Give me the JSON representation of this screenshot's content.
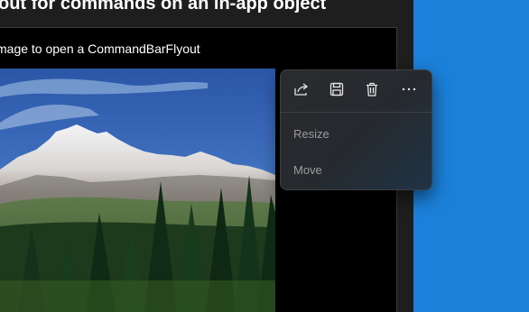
{
  "page": {
    "title": "out for commands on an in-app object",
    "instruction": "mage to open a CommandBarFlyout"
  },
  "photo": {
    "subject": "mountain-landscape-image"
  },
  "flyout": {
    "primary_commands": [
      {
        "name": "share",
        "icon": "share-icon"
      },
      {
        "name": "save",
        "icon": "save-icon"
      },
      {
        "name": "delete",
        "icon": "delete-icon"
      },
      {
        "name": "more",
        "icon": "more-icon"
      }
    ],
    "secondary_commands": [
      {
        "label": "Resize"
      },
      {
        "label": "Move"
      }
    ]
  },
  "colors": {
    "window_bg": "#1e1e1e",
    "panel_bg": "#000000",
    "desktop_blue": "#1b80d9",
    "menu_text": "#9b9b9b"
  }
}
